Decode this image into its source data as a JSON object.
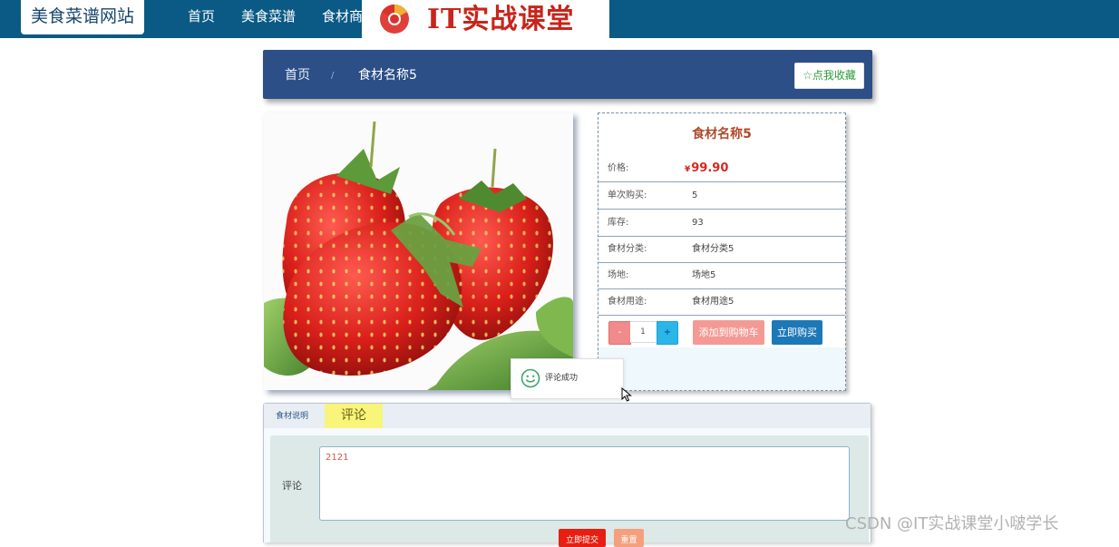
{
  "navbar": {
    "brand": "美食菜谱网站",
    "links": [
      "首页",
      "美食菜谱",
      "食材商"
    ],
    "logo_text": "IT实战课堂"
  },
  "breadcrumb": {
    "home": "首页",
    "separator": "/",
    "current": "食材名称5",
    "favorite_label": "☆点我收藏"
  },
  "product": {
    "image_icon": "strawberry-photo",
    "title": "食材名称5",
    "price_label": "价格:",
    "currency": "¥",
    "price": "99.90",
    "rows": [
      {
        "label": "单次购买:",
        "value": "5"
      },
      {
        "label": "库存:",
        "value": "93"
      },
      {
        "label": "食材分类:",
        "value": "食材分类5"
      },
      {
        "label": "场地:",
        "value": "场地5"
      },
      {
        "label": "食材用途:",
        "value": "食材用途5"
      }
    ],
    "qty_minus": "-",
    "qty_value": "1",
    "qty_plus": "+",
    "add_to_cart": "添加到购物车",
    "buy_now": "立即购买"
  },
  "toast": {
    "icon": "smile-icon",
    "message": "评论成功"
  },
  "tabs": {
    "desc_tab": "食材说明",
    "comment_tab": "评论",
    "comment_label": "评论",
    "comment_value": "2121",
    "submit": "立即提交",
    "reset": "重置"
  },
  "watermark": "CSDN @IT实战课堂小啵学长",
  "colors": {
    "navbar": "#0a5a85",
    "breadcrumb": "#2b4f86",
    "price": "#d32a1e",
    "buy": "#1d78b7",
    "submit": "#e81e12"
  }
}
